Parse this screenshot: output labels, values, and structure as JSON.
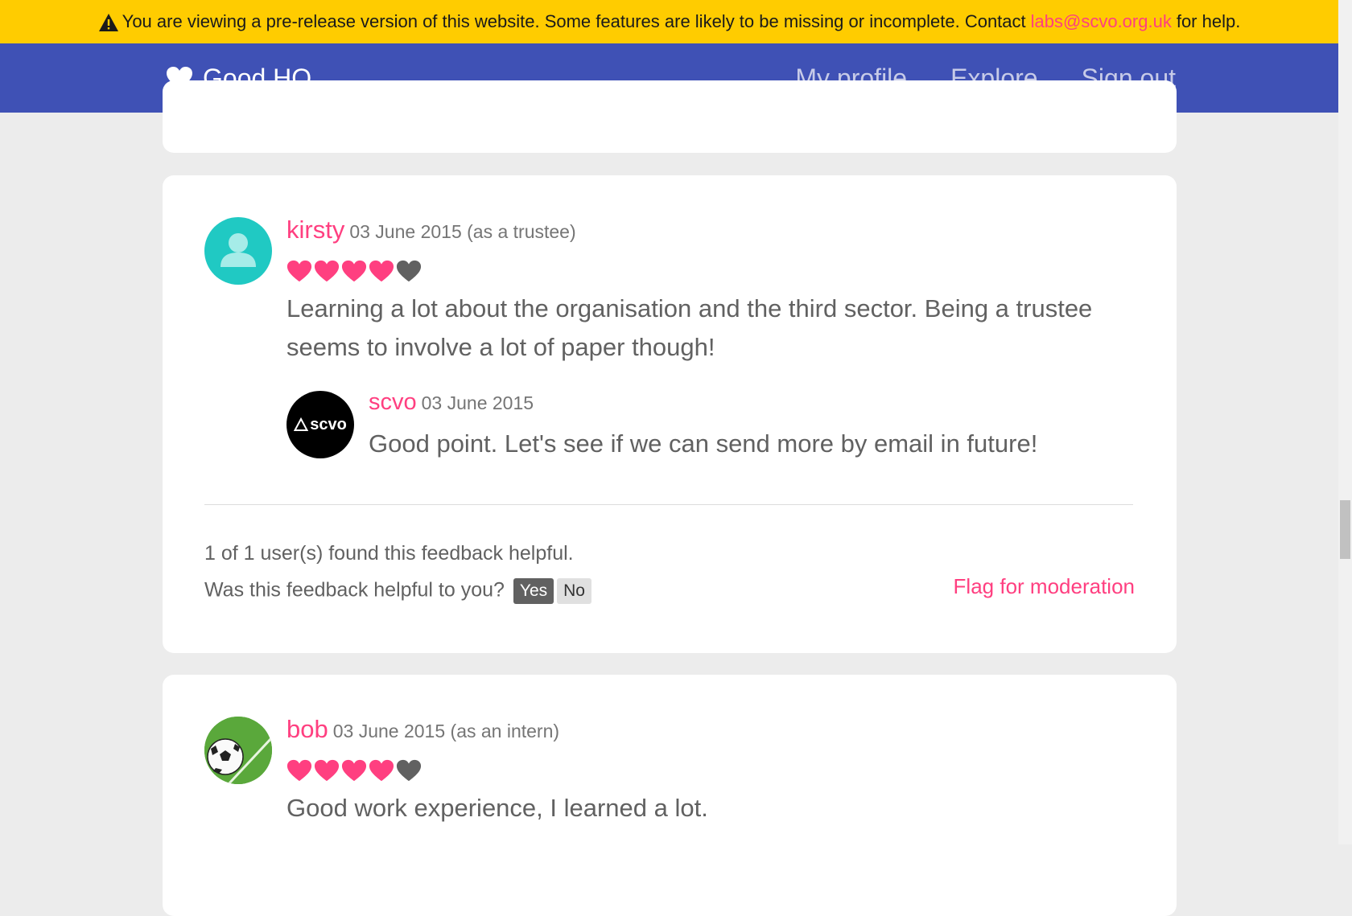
{
  "banner": {
    "text_before": "You are viewing a pre-release version of this website. Some features are likely to be missing or incomplete. Contact",
    "email": "labs@scvo.org.uk",
    "text_after": "for help.",
    "icon": "warning-icon"
  },
  "nav": {
    "brand": "Good HQ",
    "brand_icon": "heart-icon",
    "links": [
      "My profile",
      "Explore",
      "Sign out"
    ]
  },
  "colors": {
    "accent": "#ff3f80",
    "nav_bg": "#3f51b5",
    "banner_bg": "#ffcc00",
    "heart_empty": "#616161"
  },
  "reviews": [
    {
      "author": "kirsty",
      "meta": "03 June 2015 (as a trustee)",
      "rating": 4,
      "rating_max": 5,
      "text": "Learning a lot about the organisation and the third sector. Being a trustee seems to involve a lot of paper though!",
      "reply": {
        "author": "scvo",
        "date": "03 June 2015",
        "logo_text": "scvo",
        "text": "Good point. Let's see if we can send more by email in future!"
      },
      "helpful_count": "1 of 1 user(s) found this feedback helpful.",
      "helpful_question": "Was this feedback helpful to you?",
      "yes_label": "Yes",
      "no_label": "No",
      "flag_label": "Flag for moderation"
    },
    {
      "author": "bob",
      "meta": "03 June 2015 (as an intern)",
      "rating": 4,
      "rating_max": 5,
      "text": "Good work experience, I learned a lot."
    }
  ]
}
